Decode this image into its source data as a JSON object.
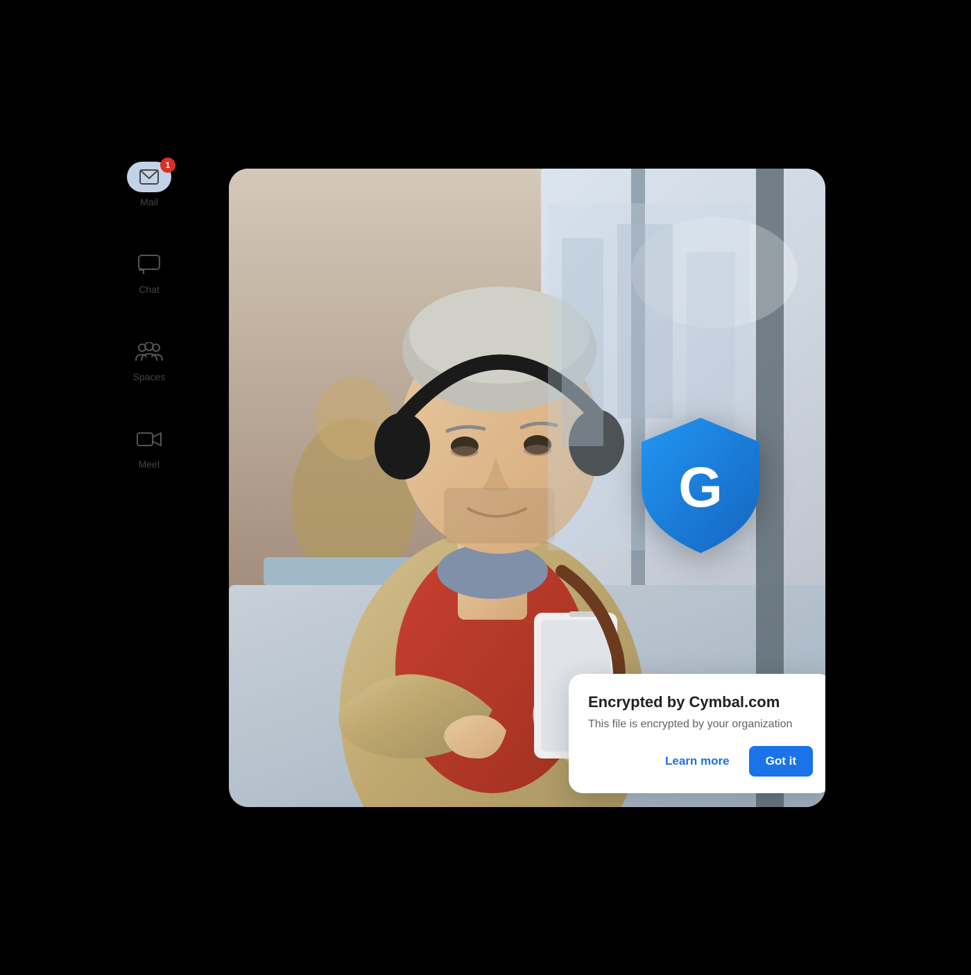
{
  "sidebar": {
    "items": [
      {
        "id": "mail",
        "label": "Mail",
        "badge": "1",
        "has_badge": true
      },
      {
        "id": "chat",
        "label": "Chat",
        "has_badge": false
      },
      {
        "id": "spaces",
        "label": "Spaces",
        "has_badge": false
      },
      {
        "id": "meet",
        "label": "Meet",
        "has_badge": false
      }
    ]
  },
  "encryption_card": {
    "title": "Encrypted by Cymbal.com",
    "subtitle": "This file is encrypted by your organization",
    "learn_more_label": "Learn more",
    "got_it_label": "Got it"
  },
  "shield": {
    "letter": "G"
  },
  "colors": {
    "blue_primary": "#1a73e8",
    "shield_dark": "#1557a0",
    "shield_mid": "#1a73e8",
    "badge_red": "#d93025",
    "mail_pill": "#c2d3e8"
  }
}
